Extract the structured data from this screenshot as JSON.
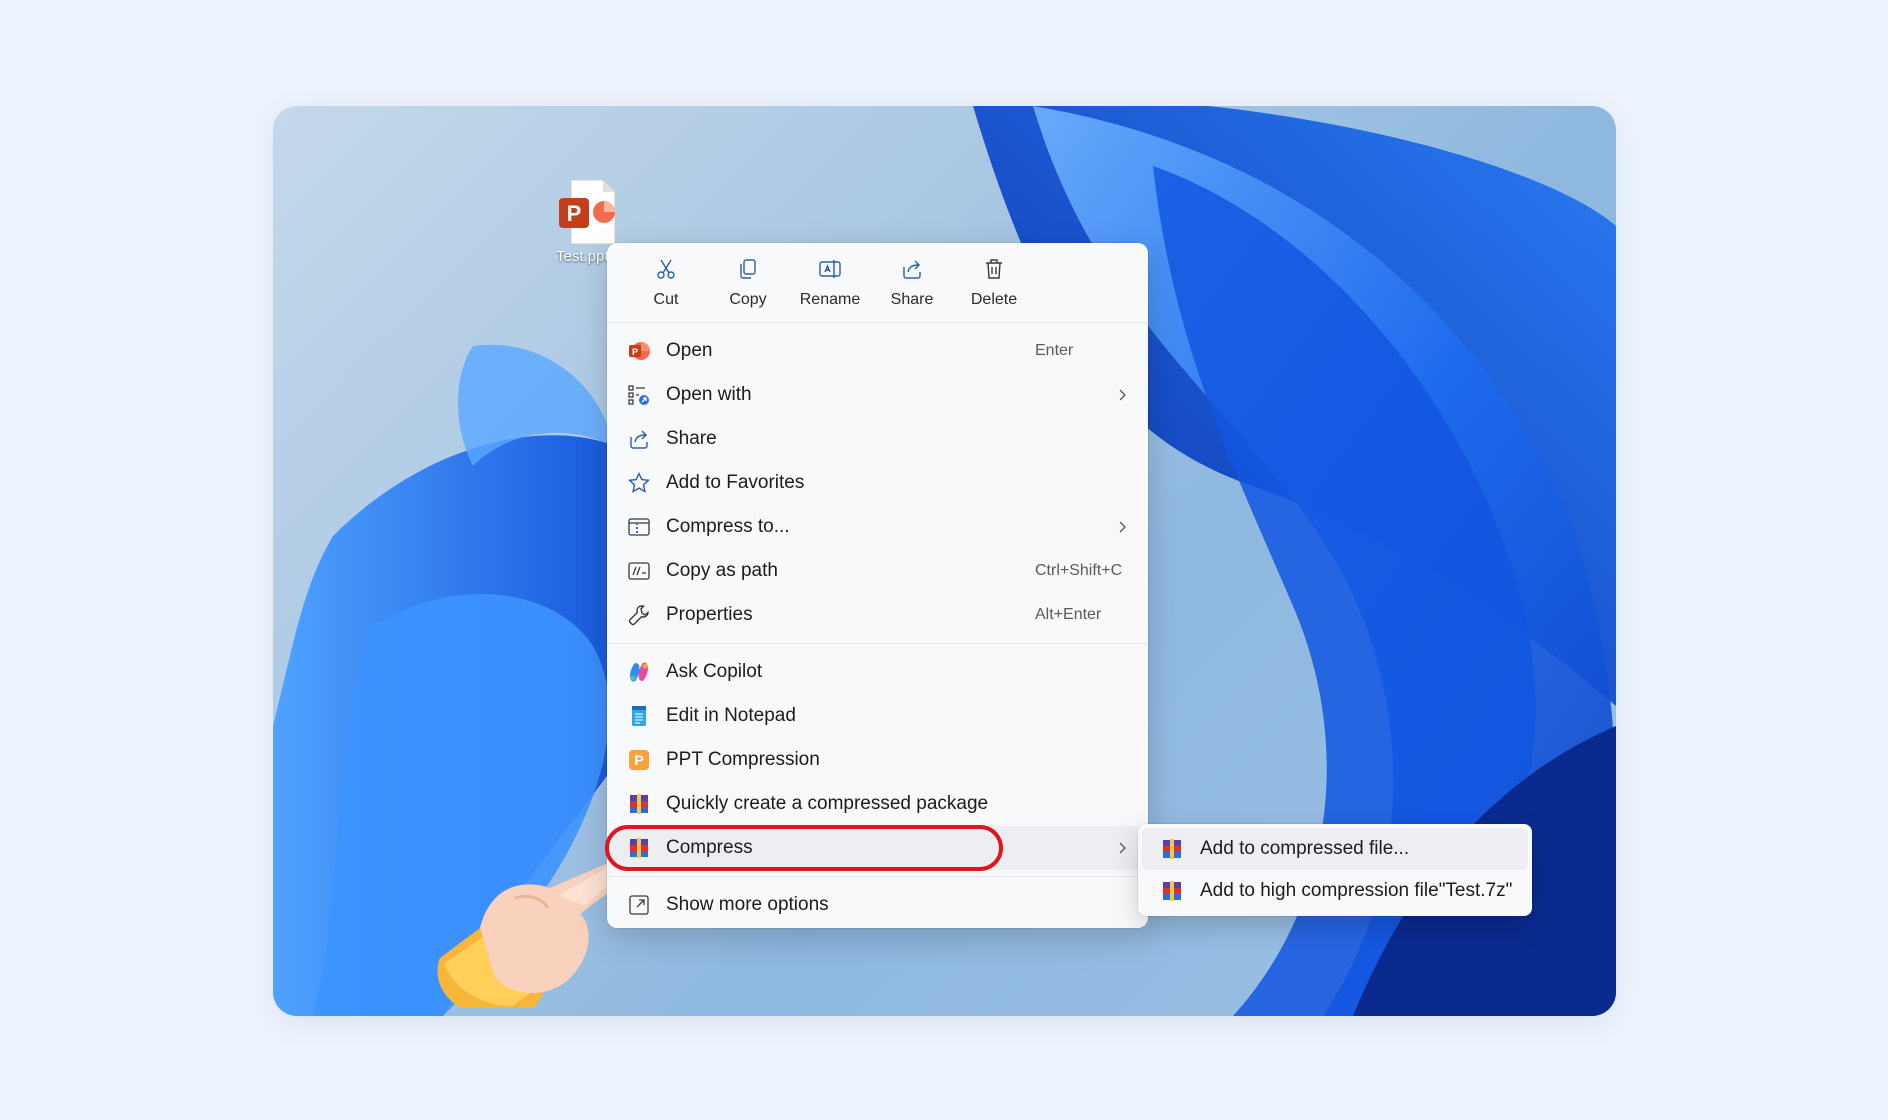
{
  "desktop": {
    "file": {
      "label": "Test.pptx",
      "icon": "powerpoint-file-icon"
    }
  },
  "context_menu": {
    "toolbar": [
      {
        "name": "cut-button",
        "icon": "scissors-icon",
        "label": "Cut"
      },
      {
        "name": "copy-button",
        "icon": "copy-icon",
        "label": "Copy"
      },
      {
        "name": "rename-button",
        "icon": "rename-icon",
        "label": "Rename"
      },
      {
        "name": "share-button",
        "icon": "share-icon",
        "label": "Share"
      },
      {
        "name": "delete-button",
        "icon": "trash-icon",
        "label": "Delete"
      }
    ],
    "items": [
      {
        "label": "Open",
        "shortcut": "Enter",
        "icon": "powerpoint-icon"
      },
      {
        "label": "Open with",
        "icon": "open-with-icon",
        "submenu": true
      },
      {
        "label": "Share",
        "icon": "share-icon"
      },
      {
        "label": "Add to Favorites",
        "icon": "star-icon"
      },
      {
        "label": "Compress to...",
        "icon": "zip-folder-icon",
        "submenu": true
      },
      {
        "label": "Copy as path",
        "shortcut": "Ctrl+Shift+C",
        "icon": "path-icon"
      },
      {
        "label": "Properties",
        "shortcut": "Alt+Enter",
        "icon": "wrench-icon"
      },
      {
        "label": "Ask Copilot",
        "icon": "copilot-icon"
      },
      {
        "label": "Edit in Notepad",
        "icon": "notepad-icon"
      },
      {
        "label": "PPT Compression",
        "icon": "ppt-compression-icon"
      },
      {
        "label": "Quickly create a compressed package",
        "icon": "archive-icon"
      },
      {
        "label": "Compress",
        "icon": "archive-icon",
        "submenu": true
      },
      {
        "label": "Show more options",
        "icon": "expand-icon"
      }
    ]
  },
  "submenu": {
    "items": [
      {
        "label": "Add to compressed file...",
        "icon": "archive-icon"
      },
      {
        "label": "Add to high compression file\"Test.7z\"",
        "icon": "archive-icon"
      }
    ]
  },
  "colors": {
    "highlight": "#e3141f",
    "accent": "#1f6fe0"
  }
}
